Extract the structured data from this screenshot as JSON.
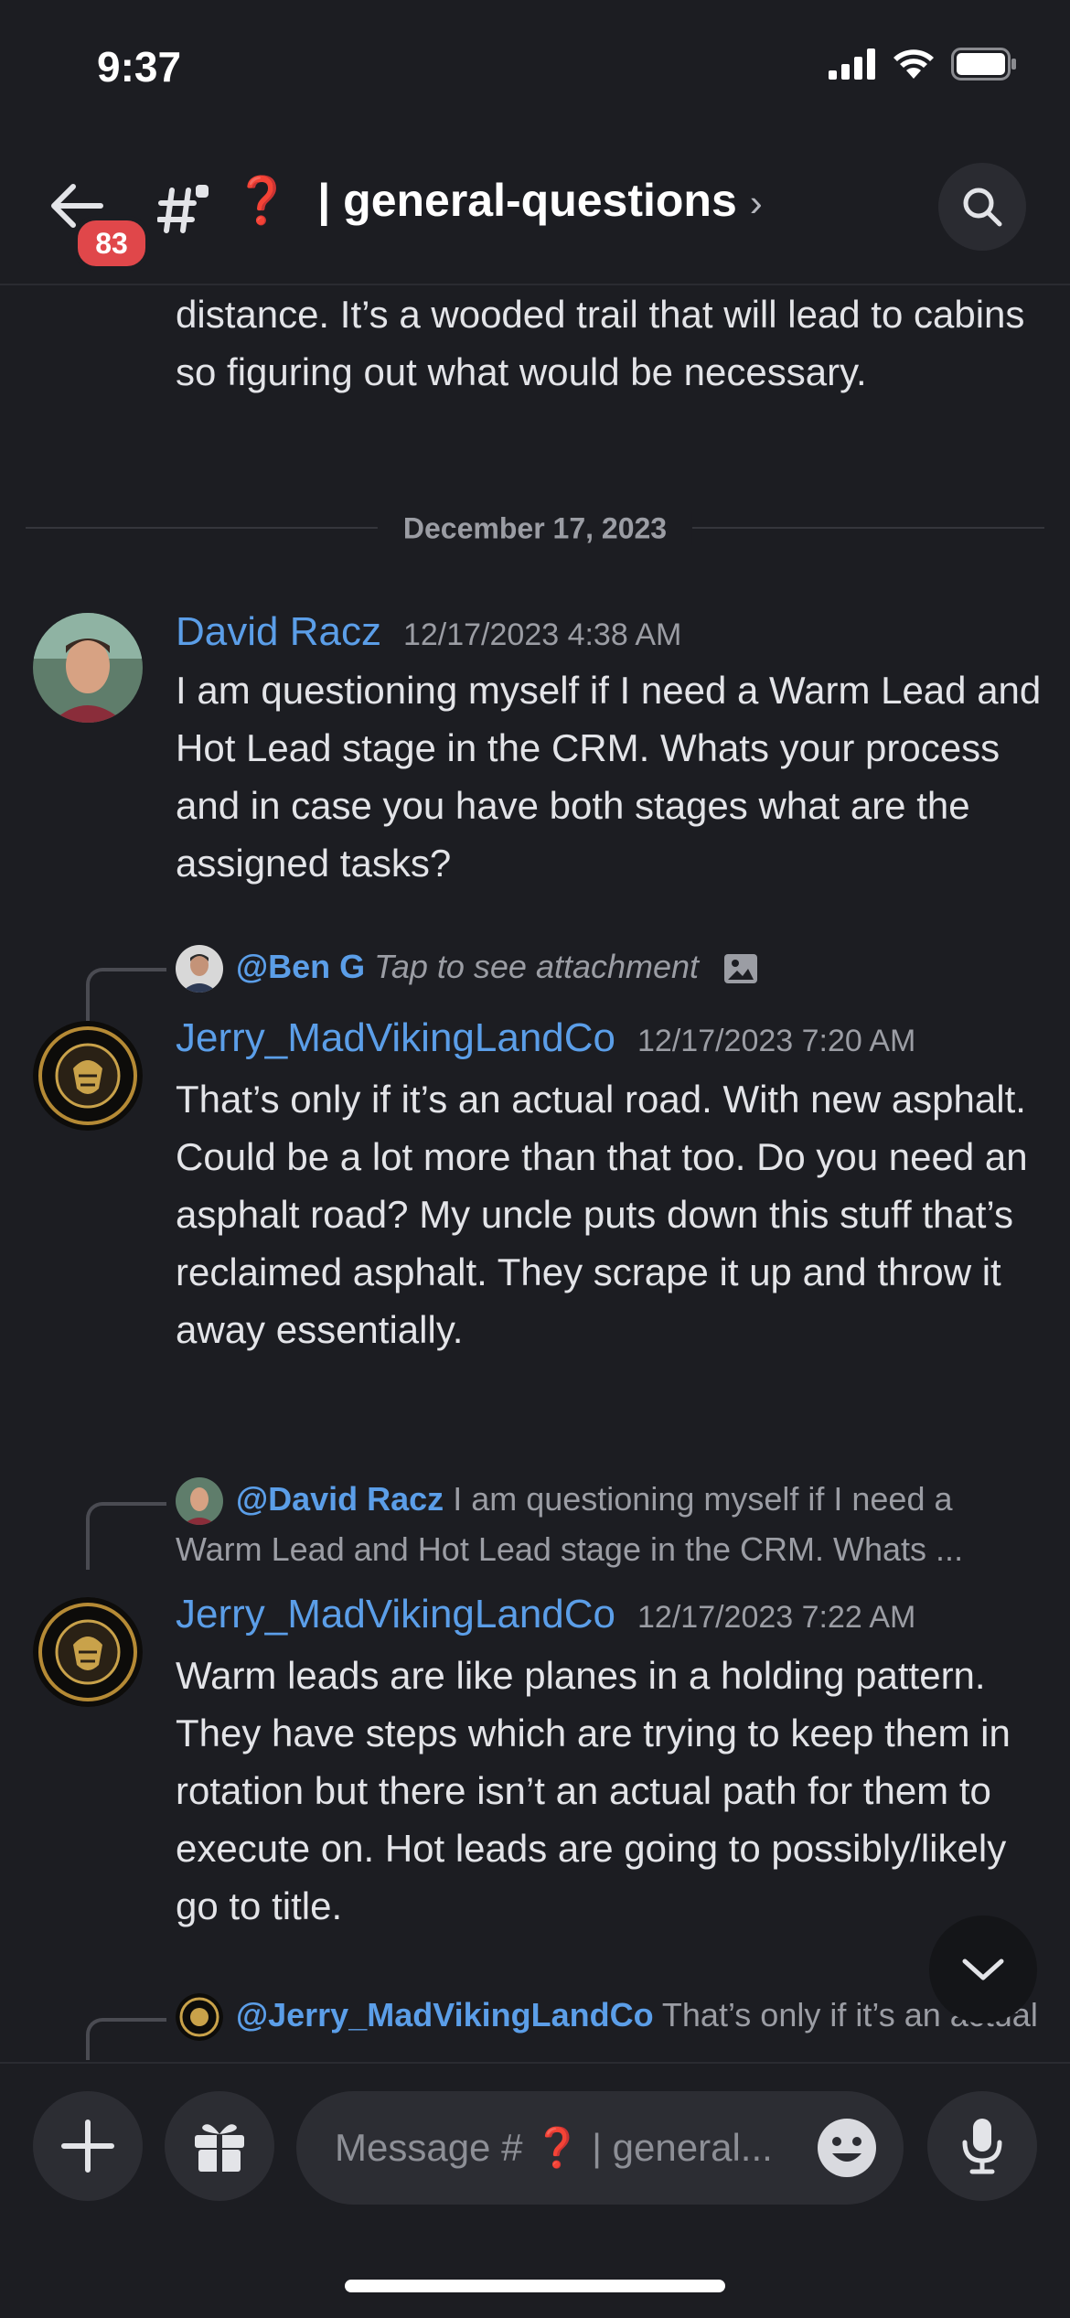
{
  "status_bar": {
    "time": "9:37"
  },
  "header": {
    "unread_count": "83",
    "channel_emoji": "❓",
    "channel_name": "| general-questions",
    "chevron": "›"
  },
  "feed": {
    "prev_message_tail": "distance. It’s a wooded trail that will lead to cabins so figuring out what would be necessary.",
    "date_divider": "December 17, 2023",
    "messages": [
      {
        "author": "David Racz",
        "timestamp": "12/17/2023 4:38 AM",
        "text": "I am questioning myself if I need a Warm Lead and Hot Lead stage in the CRM. Whats your process and in case you have both stages what are the assigned tasks?"
      },
      {
        "reply_to": "@Ben G",
        "reply_preview": "Tap to see attachment",
        "author": "Jerry_MadVikingLandCo",
        "timestamp": "12/17/2023 7:20 AM",
        "text": "That’s only if it’s an actual road.  With new asphalt.  Could be a lot more than that too. Do you need an asphalt road? My uncle puts down this stuff that’s reclaimed asphalt. They scrape it up and throw it away essentially."
      },
      {
        "reply_to": "@David Racz",
        "reply_preview": "I am questioning myself if I need a Warm Lead and Hot Lead stage in the CRM. Whats ...",
        "author": "Jerry_MadVikingLandCo",
        "timestamp": "12/17/2023 7:22 AM",
        "text": "Warm leads are like planes in a holding pattern.  They have steps which are trying to keep them in rotation but there isn’t an actual path for them to execute on.  Hot leads are going to possibly/likely go to title."
      },
      {
        "reply_to": "@Jerry_MadVikingLandCo",
        "reply_preview": "That’s only if it’s an actual road. With new asphalt. Could be a lot m..."
      }
    ]
  },
  "composer": {
    "placeholder_prefix": "Message # ",
    "placeholder_emoji": "❓",
    "placeholder_suffix": " | general..."
  },
  "colors": {
    "background": "#1c1d22",
    "author_blue": "#5b9ee8",
    "badge_red": "#e0474a",
    "muted": "#9b9da4"
  }
}
